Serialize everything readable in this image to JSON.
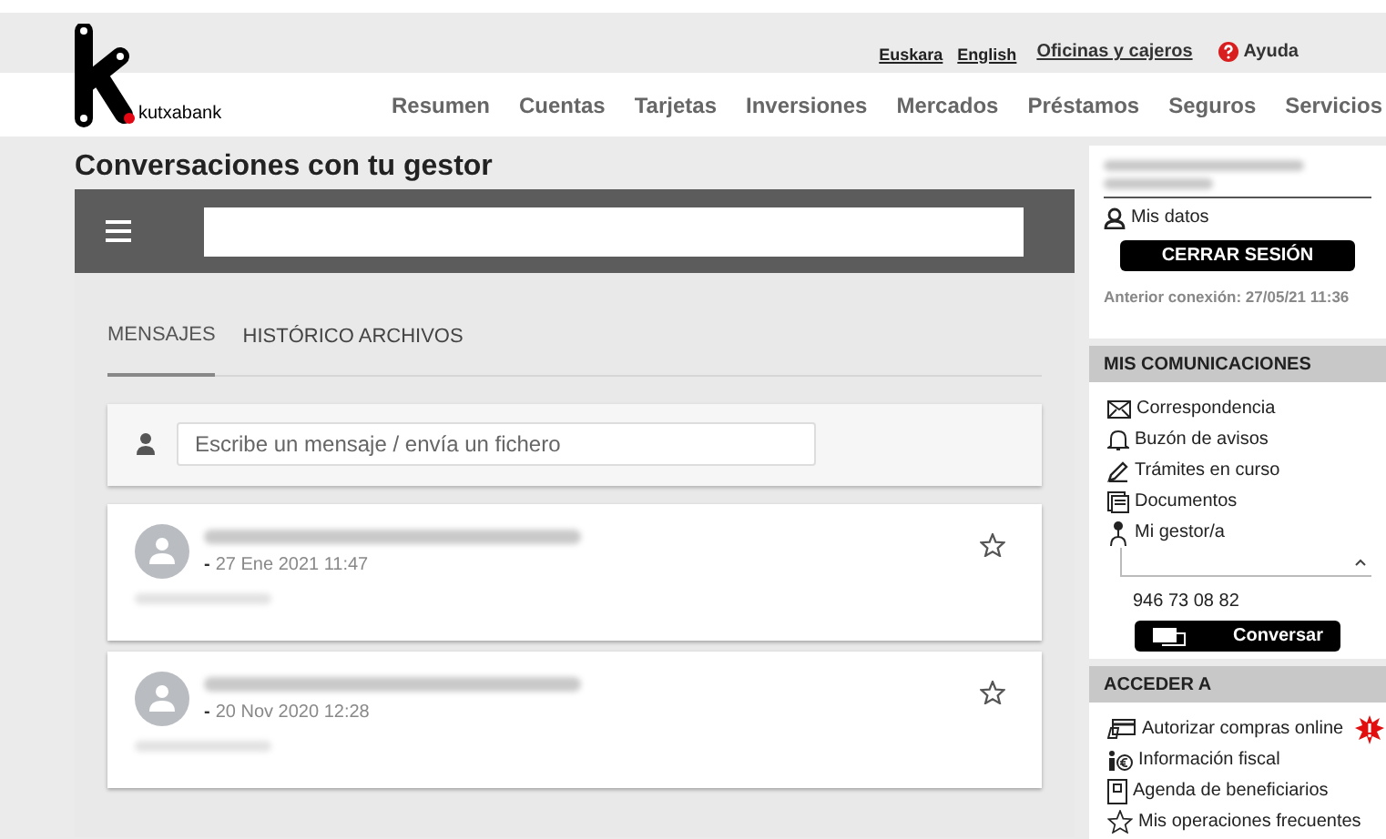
{
  "header": {
    "logo_text": "kutxabank",
    "top_links": [
      {
        "label": "Euskara",
        "kind": "lang"
      },
      {
        "label": "English",
        "kind": "lang"
      },
      {
        "label": "Oficinas y cajeros",
        "kind": "link"
      },
      {
        "label": "Ayuda",
        "kind": "help"
      }
    ],
    "nav": [
      "Resumen",
      "Cuentas",
      "Tarjetas",
      "Inversiones",
      "Mercados",
      "Préstamos",
      "Seguros",
      "Servicios"
    ]
  },
  "page_title": "Conversaciones con tu gestor",
  "tabs": [
    {
      "label": "MENSAJES",
      "selected": true
    },
    {
      "label": "HISTÓRICO ARCHIVOS",
      "selected": false
    }
  ],
  "composer": {
    "placeholder": "Escribe un mensaje / envía un fichero"
  },
  "messages": [
    {
      "dash": "-",
      "date": "27 Ene 2021 11:47",
      "starred": false
    },
    {
      "dash": "-",
      "date": "20 Nov 2020 12:28",
      "starred": false
    }
  ],
  "sidebar": {
    "user_link": "Mis datos",
    "logout": "CERRAR SESIÓN",
    "last_login": "Anterior conexión: 27/05/21 11:36",
    "communications": {
      "title": "MIS COMUNICACIONES",
      "items": [
        {
          "label": "Correspondencia",
          "kind": "mail"
        },
        {
          "label": "Buzón de avisos",
          "kind": "bell"
        },
        {
          "label": "Trámites en curso",
          "kind": "pen"
        },
        {
          "label": "Documentos",
          "kind": "docs"
        },
        {
          "label": "Mi gestor/a",
          "kind": "person"
        }
      ],
      "phone": "946 73 08 82",
      "chat_button": "Conversar"
    },
    "access": {
      "title": "ACCEDER A",
      "items": [
        {
          "label": "Autorizar compras online",
          "kind": "card",
          "alert": true
        },
        {
          "label": "Información fiscal",
          "kind": "info",
          "alert": false
        },
        {
          "label": "Agenda de beneficiarios",
          "kind": "agenda",
          "alert": false
        },
        {
          "label": "Mis operaciones frecuentes",
          "kind": "star",
          "alert": false
        }
      ]
    }
  }
}
